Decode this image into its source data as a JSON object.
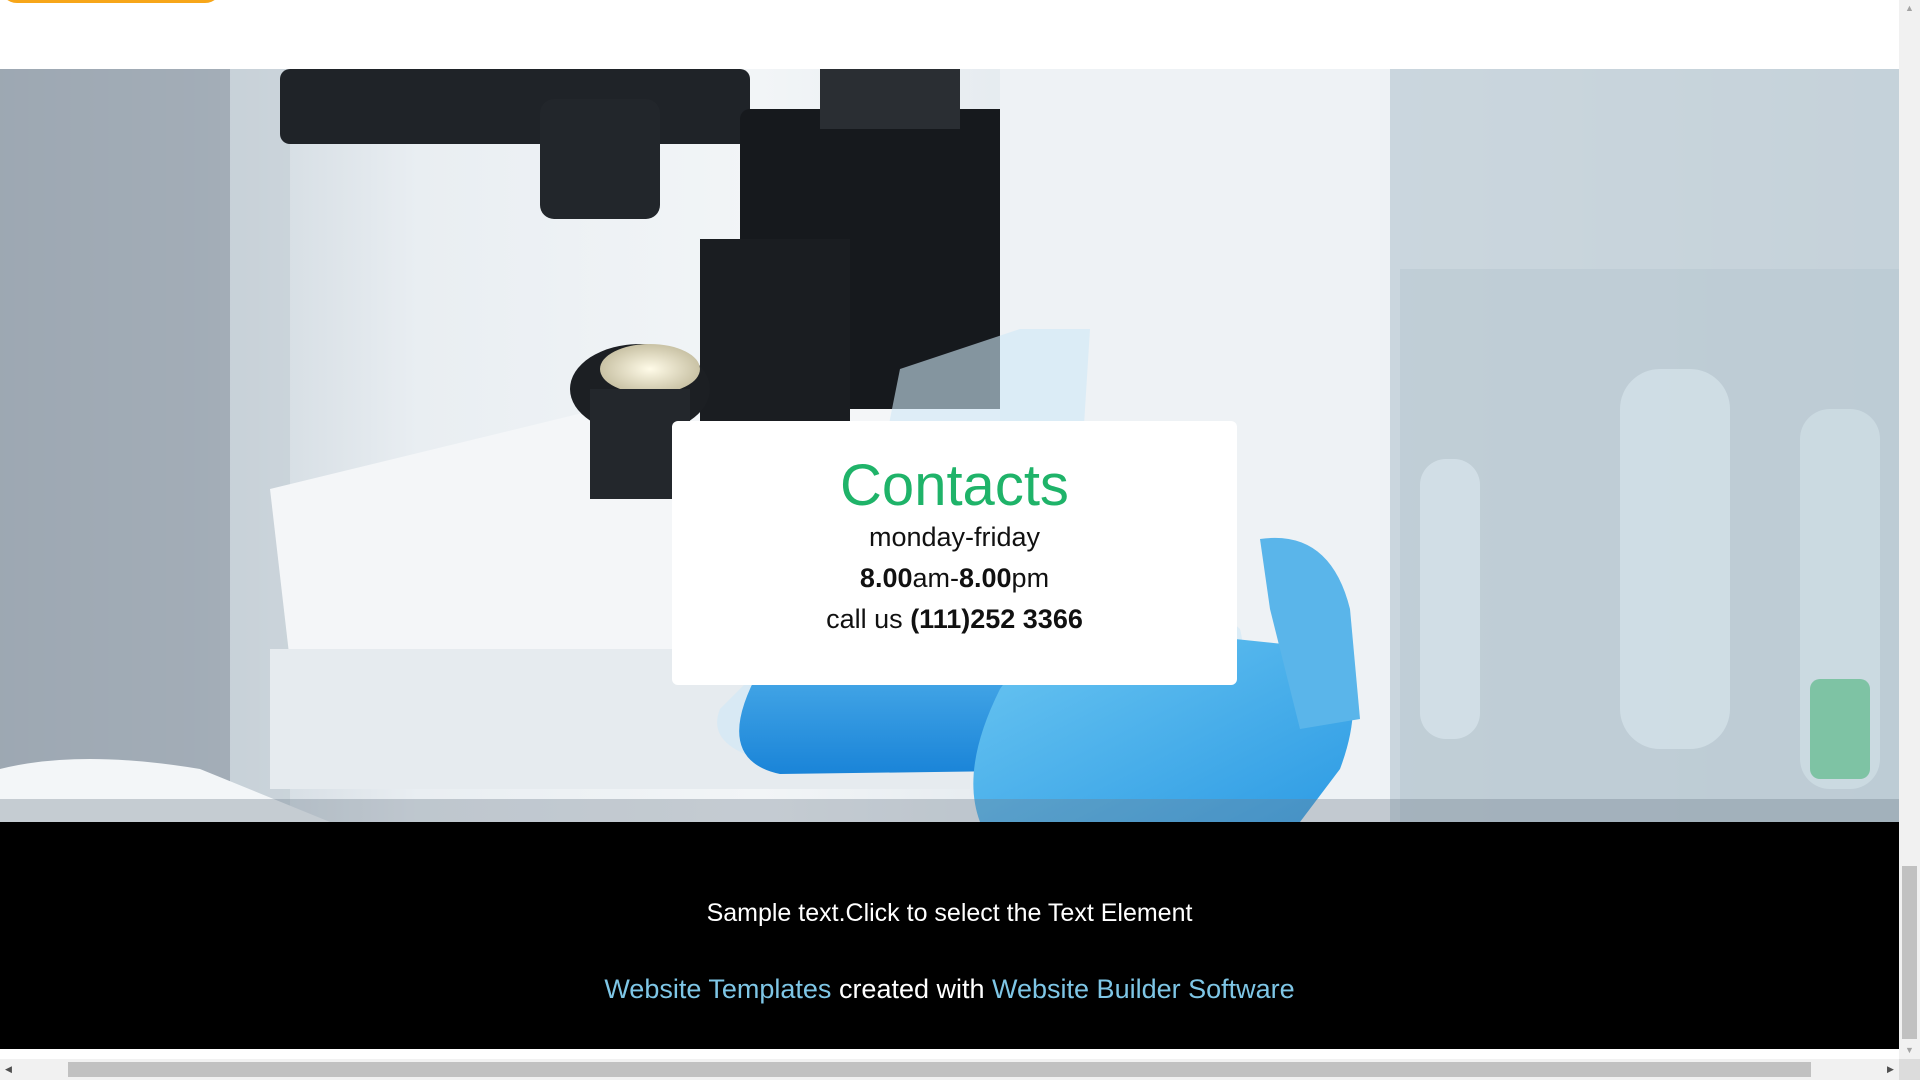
{
  "contacts": {
    "title": "Contacts",
    "days": "monday-friday",
    "hours_open_num": "8.00",
    "hours_open_suffix": "am-",
    "hours_close_num": "8.00",
    "hours_close_suffix": "pm",
    "call_prefix": "call us ",
    "phone": "(111)252 3366"
  },
  "footer": {
    "sample_text": "Sample text.Click to select the Text Element",
    "link_templates": "Website Templates",
    "created_with": " created with ",
    "link_builder": "Website Builder Software"
  },
  "scrollbars": {
    "up_arrow": "▲",
    "down_arrow": "▼",
    "left_arrow": "◀",
    "right_arrow": "▶"
  },
  "colors": {
    "accent_green": "#1fb369",
    "link_blue": "#7ec6e6",
    "orange_button": "#f7a619",
    "footer_bg": "#000000"
  },
  "icons": {
    "up": "scroll-up-arrow-icon",
    "down": "scroll-down-arrow-icon",
    "left": "scroll-left-arrow-icon",
    "right": "scroll-right-arrow-icon"
  }
}
